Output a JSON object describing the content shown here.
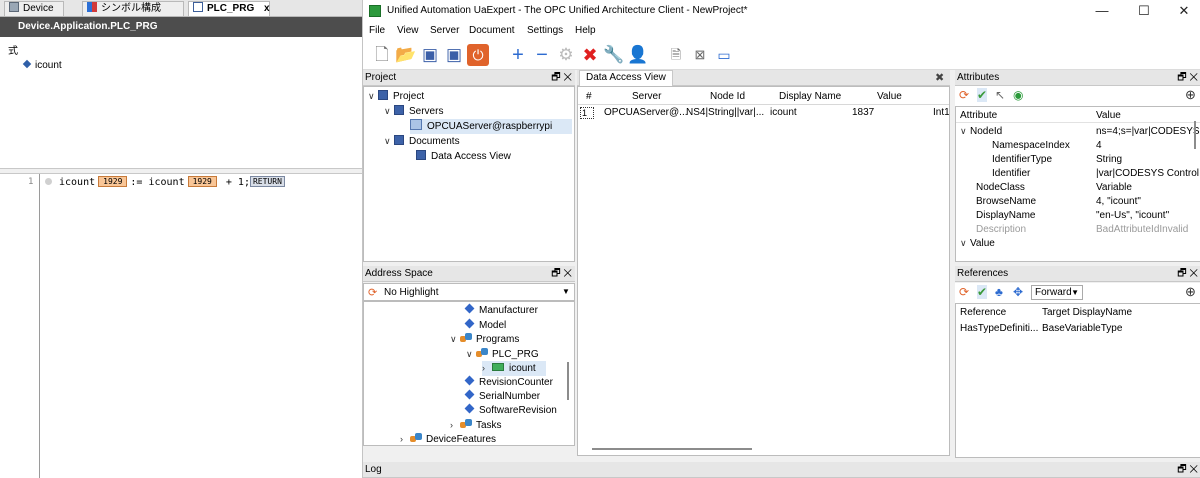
{
  "codesys": {
    "tabs": [
      {
        "label": "Device"
      },
      {
        "label": "シンボル構成"
      },
      {
        "label": "PLC_PRG",
        "close": "x"
      }
    ],
    "path": "Device.Application.PLC_PRG",
    "expr_label": "式",
    "variable": "icount",
    "code": {
      "line_number": "1",
      "token1": "icount",
      "value1": "1929",
      "assign": ":=",
      "token2": "icount",
      "value2": "1929",
      "rest": "+ 1;",
      "return_tag": "RETURN"
    }
  },
  "uaexpert": {
    "title": "Unified Automation UaExpert - The OPC Unified Architecture Client - NewProject*",
    "window_buttons": {
      "minimize": "—",
      "maximize": "☐",
      "close": "✕"
    },
    "menu": [
      "File",
      "View",
      "Server",
      "Document",
      "Settings",
      "Help"
    ],
    "project_panel": {
      "title": "Project",
      "tree": [
        {
          "label": "Project"
        },
        {
          "label": "Servers"
        },
        {
          "label": "OPCUAServer@raspberrypi"
        },
        {
          "label": "Documents"
        },
        {
          "label": "Data Access View"
        }
      ]
    },
    "dav_panel": {
      "tab": "Data Access View",
      "columns": [
        "#",
        "Server",
        "Node Id",
        "Display Name",
        "Value"
      ],
      "rows": [
        {
          "num": "1",
          "server": "OPCUAServer@...",
          "nodeid": "NS4|String||var|...",
          "display": "icount",
          "value": "1837",
          "type": "Int1"
        }
      ]
    },
    "address_panel": {
      "title": "Address Space",
      "highlight": "No Highlight",
      "tree": [
        {
          "label": "Manufacturer"
        },
        {
          "label": "Model"
        },
        {
          "label": "Programs"
        },
        {
          "label": "PLC_PRG"
        },
        {
          "label": "icount"
        },
        {
          "label": "RevisionCounter"
        },
        {
          "label": "SerialNumber"
        },
        {
          "label": "SoftwareRevision"
        },
        {
          "label": "Tasks"
        },
        {
          "label": "DeviceFeatures"
        }
      ]
    },
    "attributes_panel": {
      "title": "Attributes",
      "columns": [
        "Attribute",
        "Value"
      ],
      "rows": [
        {
          "attr": "NodeId",
          "value": "ns=4;s=|var|CODESYS"
        },
        {
          "attr": "NamespaceIndex",
          "value": "4"
        },
        {
          "attr": "IdentifierType",
          "value": "String"
        },
        {
          "attr": "Identifier",
          "value": "|var|CODESYS Control"
        },
        {
          "attr": "NodeClass",
          "value": "Variable"
        },
        {
          "attr": "BrowseName",
          "value": "4, \"icount\""
        },
        {
          "attr": "DisplayName",
          "value": "\"en-Us\", \"icount\""
        },
        {
          "attr": "Description",
          "value": "BadAttributeIdInvalid"
        },
        {
          "attr": "Value",
          "value": ""
        }
      ]
    },
    "references_panel": {
      "title": "References",
      "direction": "Forward",
      "columns": [
        "Reference",
        "Target DisplayName"
      ],
      "rows": [
        {
          "ref": "HasTypeDefiniti...",
          "target": "BaseVariableType"
        }
      ]
    },
    "log_panel": {
      "title": "Log"
    }
  }
}
